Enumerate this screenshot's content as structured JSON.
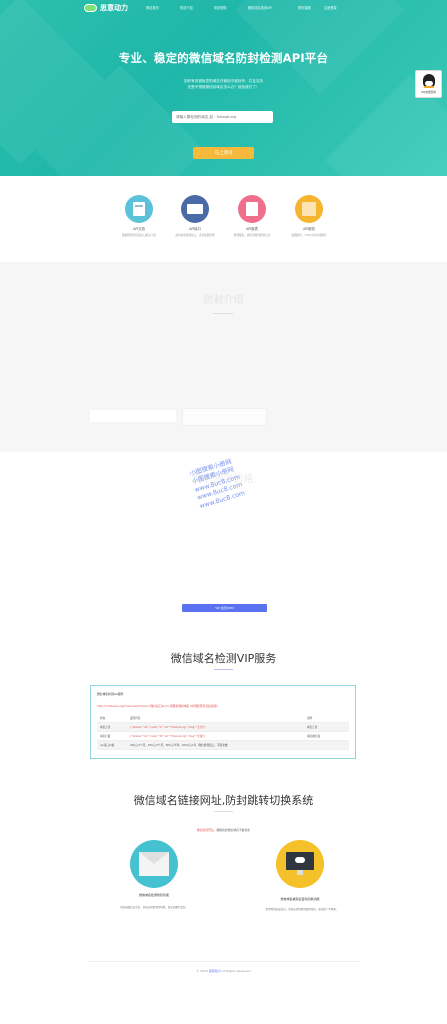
{
  "brand": {
    "name": "思意动力"
  },
  "nav": {
    "items": [
      "网站首页",
      "防封介绍",
      "防封服务",
      "微信域名检测API",
      "联系客服",
      "注册登录"
    ]
  },
  "hero": {
    "title": "专业、稳定的微信域名防封检测API平台",
    "subtitle_line1": "如何有效避免您的域名在微信中被封杀，并且支持",
    "subtitle_line2": "还是不想被微信封域名怎么办？就找我们了！",
    "input_placeholder": "请输入需检测的域名,如：fuboob.org",
    "button": "马上测试"
  },
  "qq": {
    "label": "QQ在线咨询"
  },
  "features": [
    {
      "title": "API文档",
      "desc": "数据检测文档及接口相关介绍"
    },
    {
      "title": "API接口",
      "desc": "提供域名检测接口，支持批量检测"
    },
    {
      "title": "API报表",
      "desc": "检测报表，提供详细的检测记录"
    },
    {
      "title": "API服务",
      "desc": "客服服务，7X24小时在线服务"
    }
  ],
  "intro": {
    "title": "防封介绍"
  },
  "pricing": {
    "title": "防封服务价格",
    "button": "VIP 会员OEM"
  },
  "watermark": {
    "lines": [
      "小图搜索小册网",
      "小图搜索小册网",
      "www.8uc8.com",
      "www.8uc8.com",
      "www.8uc8.com"
    ]
  },
  "vip": {
    "title": "微信域名检测VIP服务",
    "box_head": "微信域名检测vip服务",
    "request_example": "http://1.fuboob.org/check.php?token=微信接口&url=需要检测的域名 (检测结果可直接使用)",
    "table": {
      "headers": [
        "状态",
        "返回代码",
        "说明"
      ],
      "rows": [
        {
          "status": "域名正常",
          "code": "{\"status\":\"ok\",\"code\":\"1\",\"url\":\"fuboob.org\",\"msg\":\"正常\"}",
          "note": "域名正常"
        },
        {
          "status": "域名拦截",
          "code": "{\"status\":\"ok\",\"code\":\"0\",\"url\":\"fuboob.org\",\"msg\":\"拦截\"}",
          "note": "域名被拦截"
        },
        {
          "status": "vip接口价格",
          "code": "200元/1个月，500元/3个月，800元/半年，2000元/1年（微信检测接口，不限次数）",
          "note": ""
        }
      ]
    }
  },
  "system": {
    "title": "微信域名链接网址,防封跳转切换系统",
    "subtitle_red": "微信防封开头，",
    "subtitle": "确保您的微信域名不被封杀",
    "card1": {
      "caption": "微信域名检测防封功能",
      "desc": "域名被微信封杀后，系统自动检测并切换，保证流量不丢失。"
    },
    "card2": {
      "caption": "微信域名被封后自动切换功能",
      "desc": "检测到域名被封后，系统自动切换到备用域名，保证推广不中断。"
    }
  },
  "footer": {
    "text_prefix": "© 2018",
    "brand": "思意动力",
    "text_suffix": "All Rights Reserved"
  },
  "colors": {
    "accent": "#22bba9",
    "button": "#f7b93b",
    "link": "#5a72f0",
    "alert": "#e04b4b"
  }
}
